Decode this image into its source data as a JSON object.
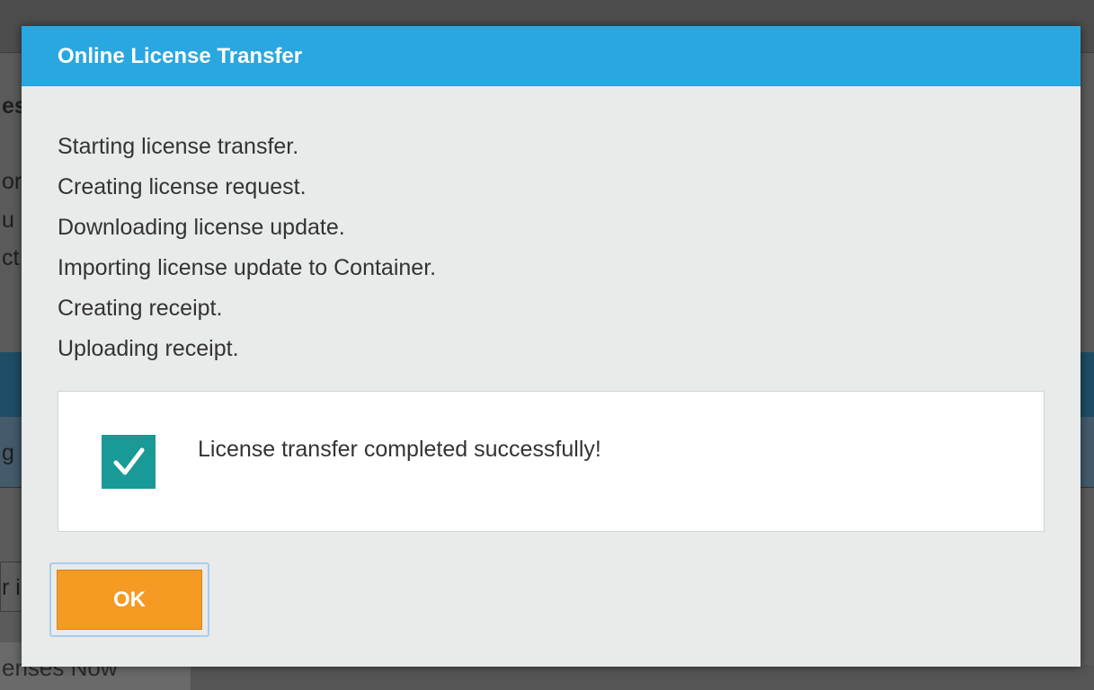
{
  "dialog": {
    "title": "Online License Transfer",
    "log_lines": [
      "Starting license transfer.",
      "Creating license request.",
      "Downloading license update.",
      "Importing license update to Container.",
      "Creating receipt.",
      "Uploading receipt."
    ],
    "result_message": "License transfer completed successfully!",
    "result_icon": "check-icon",
    "ok_label": "OK"
  },
  "background": {
    "fragments": [
      "es",
      "or",
      "u",
      "ct",
      "g",
      "r i"
    ],
    "bottom_button_label": "enses Now"
  },
  "colors": {
    "header": "#29a7e1",
    "dialog_body": "#e8ebea",
    "check_badge": "#1a9a96",
    "ok_button": "#f59a23",
    "overlay": "#555555"
  }
}
